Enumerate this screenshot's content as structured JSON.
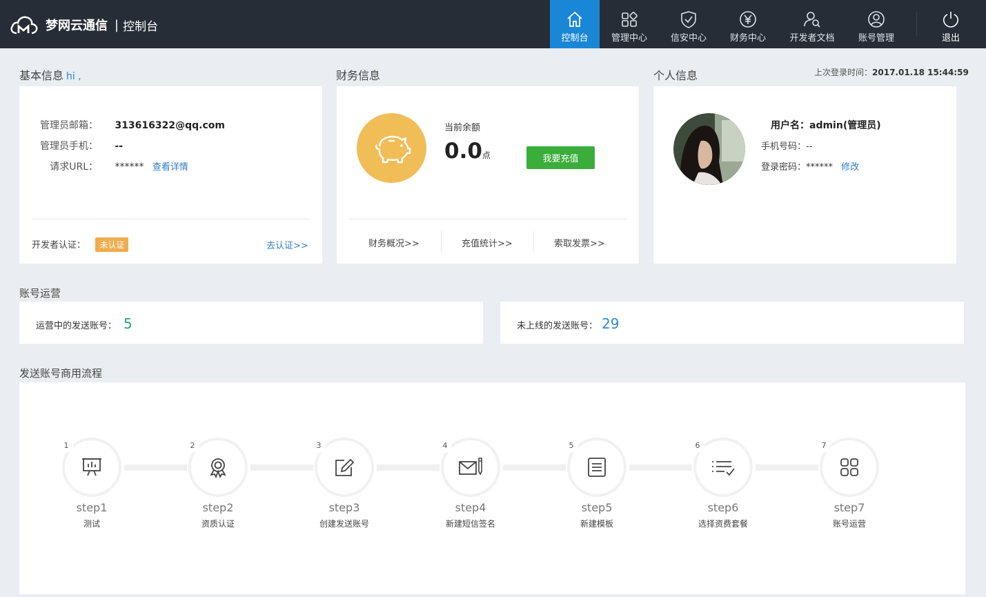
{
  "header": {
    "brand": "梦网云通信",
    "separator": "|",
    "subtitle": "控制台",
    "nav": [
      {
        "label": "控制台",
        "icon": "home-icon",
        "active": true
      },
      {
        "label": "管理中心",
        "icon": "grid-icon",
        "active": false
      },
      {
        "label": "信安中心",
        "icon": "shield-icon",
        "active": false
      },
      {
        "label": "财务中心",
        "icon": "yen-icon",
        "active": false
      },
      {
        "label": "开发者文档",
        "icon": "developer-search-icon",
        "active": false
      },
      {
        "label": "账号管理",
        "icon": "user-circle-icon",
        "active": false
      }
    ],
    "logout_label": "退出"
  },
  "basic_info": {
    "title": "基本信息",
    "hi": "hi ,",
    "email_label": "管理员邮箱：",
    "email_value": "313616322@qq.com",
    "phone_label": "管理员手机：",
    "phone_value": "--",
    "url_label": "请求URL：",
    "url_value": "******",
    "url_link": "查看详情",
    "dev_cert_label": "开发者认证：",
    "dev_cert_status": "未认证",
    "dev_cert_link": "去认证>>"
  },
  "finance": {
    "title": "财务信息",
    "balance_label": "当前余额",
    "balance_value": "0.0",
    "balance_unit": "点",
    "recharge_button": "我要充值",
    "links": [
      "财务概况>>",
      "充值统计>>",
      "索取发票>>"
    ]
  },
  "personal": {
    "title": "个人信息",
    "last_login_label": "上次登录时间：",
    "last_login_value": "2017.01.18 15:44:59",
    "username_label": "用户名：",
    "username_value": "admin(管理员)",
    "mobile_label": "手机号码：",
    "mobile_value": "--",
    "password_label": "登录密码：",
    "password_value": "******",
    "password_link": "修改"
  },
  "account_ops": {
    "title": "账号运营",
    "running_label": "运营中的发送账号：",
    "running_value": "5",
    "offline_label": "未上线的发送账号：",
    "offline_value": "29"
  },
  "process": {
    "title": "发送账号商用流程",
    "steps": [
      {
        "num": "1",
        "title": "step1",
        "desc": "测试",
        "icon": "presentation-icon"
      },
      {
        "num": "2",
        "title": "step2",
        "desc": "资质认证",
        "icon": "award-icon"
      },
      {
        "num": "3",
        "title": "step3",
        "desc": "创建发送账号",
        "icon": "edit-icon"
      },
      {
        "num": "4",
        "title": "step4",
        "desc": "新建短信签名",
        "icon": "mail-pen-icon"
      },
      {
        "num": "5",
        "title": "step5",
        "desc": "新建模板",
        "icon": "document-icon"
      },
      {
        "num": "6",
        "title": "step6",
        "desc": "选择资费套餐",
        "icon": "checklist-icon"
      },
      {
        "num": "7",
        "title": "step7",
        "desc": "账号运营",
        "icon": "apps-icon"
      }
    ]
  },
  "colors": {
    "topbar": "#262d37",
    "nav_active": "#1a87d6",
    "link": "#2b7dc9",
    "badge": "#f0ad4e",
    "recharge": "#3aad3a",
    "pig": "#f0bd57"
  }
}
